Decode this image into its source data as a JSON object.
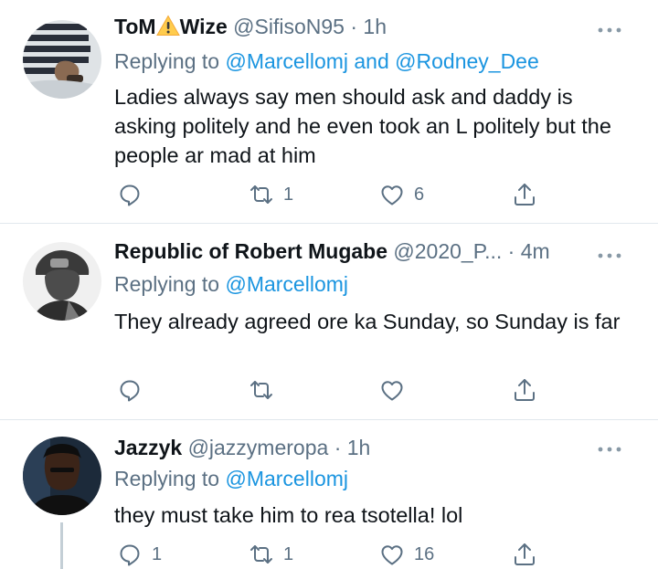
{
  "tweets": [
    {
      "name": "ToM",
      "name_after": "Wize",
      "handle": "@SifisoN95",
      "dot": "·",
      "time": "1h",
      "replying_prefix": "Replying to",
      "mentions": [
        "@Marcellomj",
        "@Rodney_Dee"
      ],
      "mention_joiner": "and",
      "text": "Ladies always say men should ask and daddy is asking politely and he even took an L politely but the people ar mad at him",
      "reply_count": "",
      "retweet_count": "1",
      "like_count": "6",
      "icons": [
        "warning-icon",
        "reply-icon",
        "retweet-icon",
        "like-icon",
        "share-icon",
        "more-icon"
      ]
    },
    {
      "name": "Republic of Robert Mugabe",
      "handle": "@2020_P...",
      "dot": "·",
      "time": "4m",
      "replying_prefix": "Replying to",
      "mentions": [
        "@Marcellomj"
      ],
      "text": "They already agreed ore ka Sunday, so Sunday is far",
      "reply_count": "",
      "retweet_count": "",
      "like_count": ""
    },
    {
      "name": "Jazzyk",
      "handle": "@jazzymeropa",
      "dot": "·",
      "time": "1h",
      "replying_prefix": "Replying to",
      "mentions": [
        "@Marcellomj"
      ],
      "text": "they must take him to rea tsotella! lol",
      "reply_count": "1",
      "retweet_count": "1",
      "like_count": "16"
    }
  ],
  "colors": {
    "text": "#0f1419",
    "secondary": "#5b7083",
    "link": "#1b95e0",
    "divider": "#e1e8ed",
    "thread": "#c4cfd6",
    "warning": "#ffcc4d"
  }
}
